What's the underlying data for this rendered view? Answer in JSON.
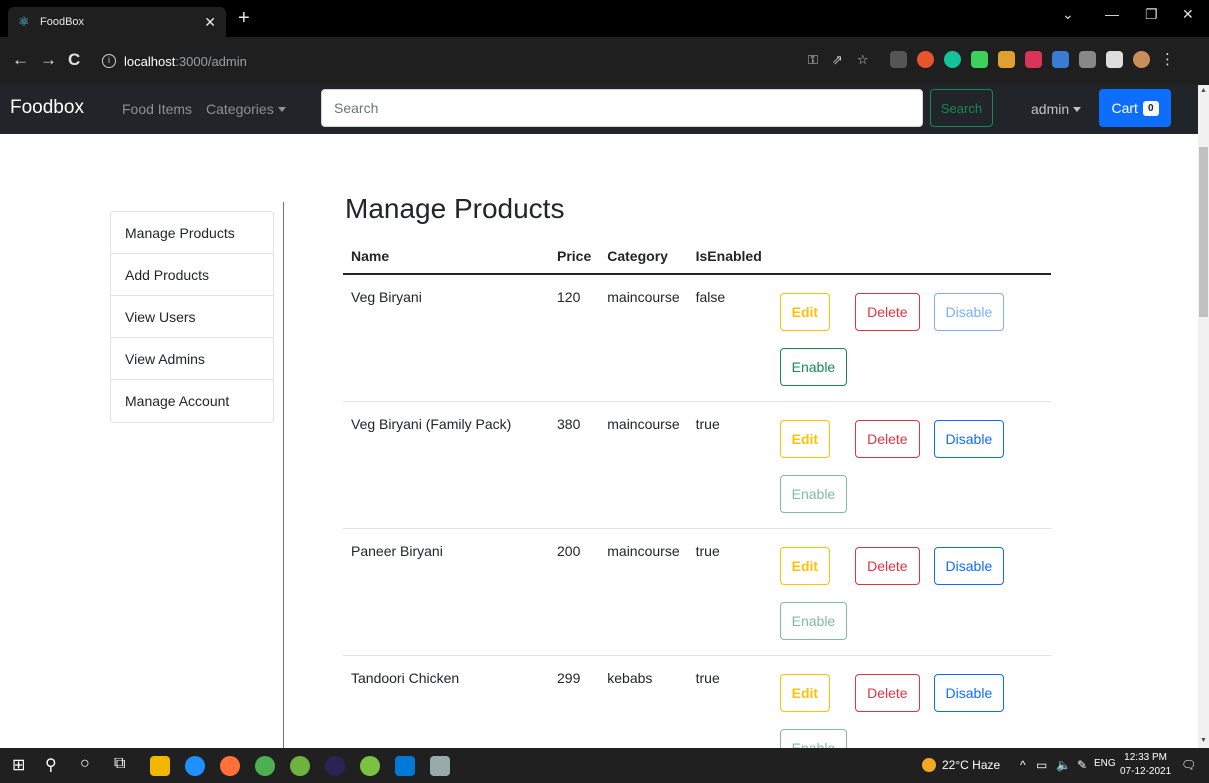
{
  "browser": {
    "tab_title": "FoodBox",
    "url_host": "localhost",
    "url_path": ":3000/admin"
  },
  "navbar": {
    "brand": "Foodbox",
    "links": [
      "Food Items",
      "Categories"
    ],
    "search_placeholder": "Search",
    "search_button": "Search",
    "user_menu": "admin",
    "cart_label": "Cart",
    "cart_count": "0"
  },
  "sidebar": {
    "items": [
      "Manage Products",
      "Add Products",
      "View Users",
      "View Admins",
      "Manage Account"
    ]
  },
  "main": {
    "title": "Manage Products",
    "columns": [
      "Name",
      "Price",
      "Category",
      "IsEnabled"
    ],
    "actions": {
      "edit": "Edit",
      "delete": "Delete",
      "disable": "Disable",
      "enable": "Enable"
    },
    "rows": [
      {
        "name": "Veg Biryani",
        "price": "120",
        "category": "maincourse",
        "enabled": "false"
      },
      {
        "name": "Veg Biryani (Family Pack)",
        "price": "380",
        "category": "maincourse",
        "enabled": "true"
      },
      {
        "name": "Paneer Biryani",
        "price": "200",
        "category": "maincourse",
        "enabled": "true"
      },
      {
        "name": "Tandoori Chicken",
        "price": "299",
        "category": "kebabs",
        "enabled": "true"
      }
    ]
  },
  "taskbar": {
    "weather": "22°C Haze",
    "language": "ENG",
    "time": "12:33 PM",
    "date": "07-12-2021"
  },
  "colors": {
    "navbar_bg": "#212529",
    "primary": "#0d6efd",
    "success": "#198754",
    "warning": "#ffc107",
    "danger": "#dc3545"
  }
}
